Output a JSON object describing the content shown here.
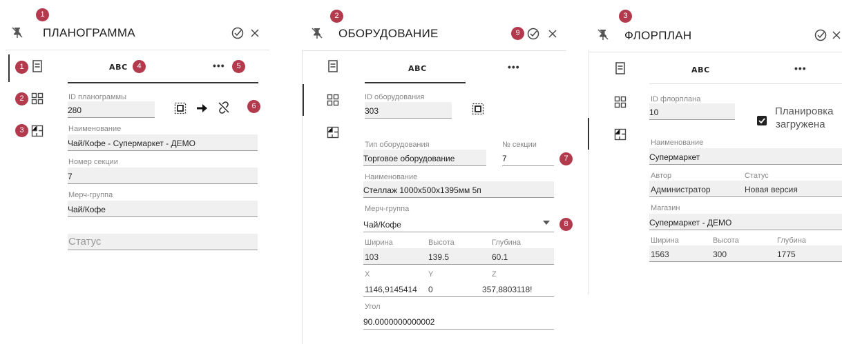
{
  "panels": {
    "planogram": {
      "title": "ПЛАНОГРАММА",
      "tab_abc": "ABC",
      "tab_more": "•••",
      "id_label": "ID планограммы",
      "id_value": "280",
      "name_label": "Наименование",
      "name_value": "Чай/Кофе - Супермаркет - ДЕМО",
      "section_label": "Номер секции",
      "section_value": "7",
      "merch_label": "Мерч-группа",
      "merch_value": "Чай/Кофе",
      "status_placeholder": "Статус"
    },
    "equipment": {
      "title": "ОБОРУДОВАНИЕ",
      "tab_abc": "ABC",
      "tab_more": "•••",
      "id_label": "ID оборудования",
      "id_value": "303",
      "type_label": "Тип оборудования",
      "type_value": "Торговое оборудование",
      "section_label": "№ секции",
      "section_value": "7",
      "name_label": "Наименование",
      "name_value": "Стеллаж 1000x500x1395мм 5п",
      "merch_label": "Мерч-группа",
      "merch_value": "Чай/Кофе",
      "width_label": "Ширина",
      "width_value": "103",
      "height_label": "Высота",
      "height_value": "139.5",
      "depth_label": "Глубина",
      "depth_value": "60.1",
      "x_label": "X",
      "x_value": "1146,9145414",
      "y_label": "Y",
      "y_value": "0",
      "z_label": "Z",
      "z_value": "357,8803118!",
      "angle_label": "Угол",
      "angle_value": "90.0000000000002"
    },
    "floorplan": {
      "title": "ФЛОРПЛАН",
      "tab_abc": "ABC",
      "tab_more": "•••",
      "id_label": "ID флорплана",
      "id_value": "10",
      "loaded_label_1": "Планировка",
      "loaded_label_2": "загружена",
      "loaded_checked": true,
      "name_label": "Наименование",
      "name_value": "Супермаркет",
      "author_label": "Автор",
      "author_value": "Администратор",
      "status_label": "Статус",
      "status_value": "Новая версия",
      "store_label": "Магазин",
      "store_value": "Супермаркет - ДЕМО",
      "width_label": "Ширина",
      "width_value": "1563",
      "height_label": "Высота",
      "height_value": "300",
      "depth_label": "Глубина",
      "depth_value": "1775"
    }
  },
  "badges": {
    "b1": "1",
    "b2": "2",
    "b3": "3",
    "b4": "4",
    "b5": "5",
    "b6": "6",
    "b7": "7",
    "b8": "8",
    "b9": "9"
  },
  "colors": {
    "badge": "#b23a4c",
    "field_bg": "#f0f0f0"
  }
}
